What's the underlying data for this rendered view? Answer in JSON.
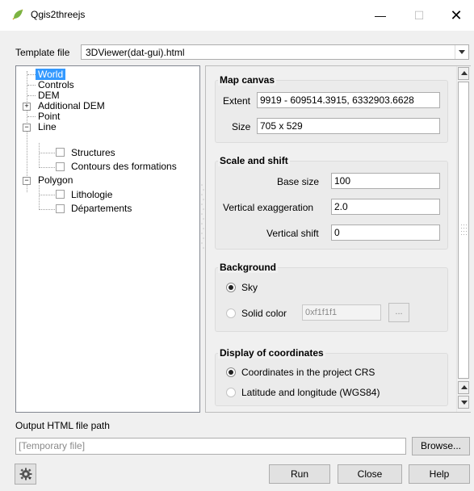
{
  "window": {
    "title": "Qgis2threejs",
    "minimize": "—",
    "maximize": "☐",
    "close": "✕"
  },
  "template": {
    "label": "Template file",
    "value": "3DViewer(dat-gui).html"
  },
  "tree": {
    "world": "World",
    "controls": "Controls",
    "dem": "DEM",
    "additional_dem": "Additional DEM",
    "point": "Point",
    "line": "Line",
    "structures": "Structures",
    "contours": "Contours des formations",
    "polygon": "Polygon",
    "lithologie": "Lithologie",
    "departements": "Départements",
    "expand_plus": "+",
    "collapse_minus": "−"
  },
  "map_canvas": {
    "title": "Map canvas",
    "extent_label": "Extent",
    "extent_value": "9919 - 609514.3915, 6332903.6628",
    "size_label": "Size",
    "size_value": "705 x 529"
  },
  "scale_shift": {
    "title": "Scale and shift",
    "base_size_label": "Base size",
    "base_size_value": "100",
    "vert_exag_label": "Vertical exaggeration",
    "vert_exag_value": "2.0",
    "vert_shift_label": "Vertical shift",
    "vert_shift_value": "0"
  },
  "background": {
    "title": "Background",
    "sky_label": "Sky",
    "solid_label": "Solid color",
    "color_value": "0xf1f1f1",
    "ellipsis": "..."
  },
  "coordinates": {
    "title": "Display of coordinates",
    "project_crs_label": "Coordinates in the project CRS",
    "latlon_label": "Latitude and longitude (WGS84)"
  },
  "output": {
    "label": "Output HTML file path",
    "placeholder": "[Temporary file]",
    "browse": "Browse..."
  },
  "buttons": {
    "run": "Run",
    "close": "Close",
    "help": "Help"
  },
  "colors": {
    "selection": "#3399ff",
    "app_icon": "#7cb342"
  },
  "icons": {
    "app": "qgis-leaf-icon",
    "settings": "gear-icon"
  }
}
